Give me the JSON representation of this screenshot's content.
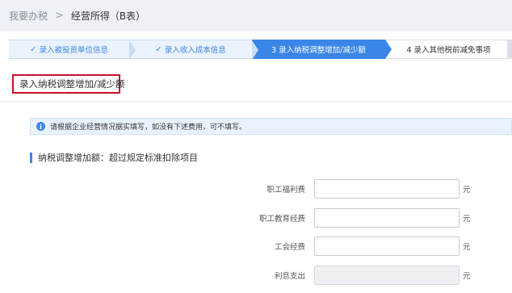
{
  "breadcrumb": {
    "home": "我要办税",
    "separator": ">",
    "current": "经营所得（B表）"
  },
  "steps": [
    {
      "label": "录入被投资单位信息",
      "state": "done"
    },
    {
      "label": "录入收入成本信息",
      "state": "done"
    },
    {
      "label": "3 录入纳税调整增加/减少额",
      "state": "active"
    },
    {
      "label": "4 录入其他税前减免事项",
      "state": "todo"
    }
  ],
  "section_title": "录入纳税调整增加/减少额",
  "notice": {
    "icon": "info-icon",
    "text": "请根据企业经营情况据实填写，如没有下述费用，可不填写。"
  },
  "sub_title": "纳税调整增加额：超过规定标准扣除项目",
  "fields": [
    {
      "label": "职工福利费",
      "value": "",
      "unit": "元",
      "disabled": false
    },
    {
      "label": "职工教育经费",
      "value": "",
      "unit": "元",
      "disabled": false
    },
    {
      "label": "工会经费",
      "value": "",
      "unit": "元",
      "disabled": false
    },
    {
      "label": "利息支出",
      "value": "",
      "unit": "元",
      "disabled": true
    }
  ],
  "colors": {
    "primary": "#3a86e8",
    "highlight_border": "#c8102e",
    "notice_bg": "#e9f3ff"
  }
}
